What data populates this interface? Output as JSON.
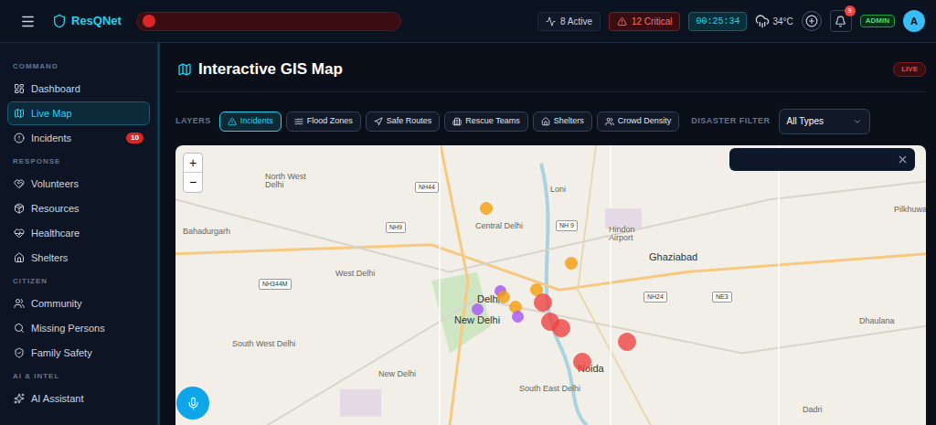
{
  "app": {
    "name": "ResQNet"
  },
  "topbar": {
    "active": "8 Active",
    "critical": "12 Critical",
    "timer": "00:25:34",
    "temperature": "34°C",
    "notifications": "9",
    "role": "ADMIN",
    "avatar": "A"
  },
  "sidebar": {
    "sections": [
      {
        "title": "COMMAND",
        "items": [
          {
            "label": "Dashboard",
            "selected": false
          },
          {
            "label": "Live Map",
            "selected": true
          },
          {
            "label": "Incidents",
            "selected": false,
            "badge": "10"
          }
        ]
      },
      {
        "title": "RESPONSE",
        "items": [
          {
            "label": "Volunteers",
            "selected": false
          },
          {
            "label": "Resources",
            "selected": false
          },
          {
            "label": "Healthcare",
            "selected": false
          },
          {
            "label": "Shelters",
            "selected": false
          }
        ]
      },
      {
        "title": "CITIZEN",
        "items": [
          {
            "label": "Community",
            "selected": false
          },
          {
            "label": "Missing Persons",
            "selected": false
          },
          {
            "label": "Family Safety",
            "selected": false
          }
        ]
      },
      {
        "title": "AI & INTEL",
        "items": [
          {
            "label": "AI Assistant",
            "selected": false
          }
        ]
      }
    ]
  },
  "page": {
    "title": "Interactive GIS Map",
    "live": "LIVE"
  },
  "layers": {
    "label": "LAYERS",
    "items": [
      {
        "label": "Incidents",
        "selected": true
      },
      {
        "label": "Flood Zones",
        "selected": false
      },
      {
        "label": "Safe Routes",
        "selected": false
      },
      {
        "label": "Rescue Teams",
        "selected": false
      },
      {
        "label": "Shelters",
        "selected": false
      },
      {
        "label": "Crowd Density",
        "selected": false
      }
    ]
  },
  "filter": {
    "label": "DISASTER FILTER",
    "value": "All Types"
  },
  "map": {
    "zoom_in": "+",
    "zoom_out": "−",
    "labels": [
      {
        "text": "North West Delhi",
        "kind": "place"
      },
      {
        "text": "Bahadurgarh",
        "kind": "place"
      },
      {
        "text": "Central Delhi",
        "kind": "place"
      },
      {
        "text": "Loni",
        "kind": "place"
      },
      {
        "text": "Hindon Airport",
        "kind": "place"
      },
      {
        "text": "Ghaziabad",
        "kind": "city"
      },
      {
        "text": "West Delhi",
        "kind": "place"
      },
      {
        "text": "Delhi",
        "kind": "city"
      },
      {
        "text": "New Delhi",
        "kind": "city"
      },
      {
        "text": "South West Delhi",
        "kind": "place"
      },
      {
        "text": "Noida",
        "kind": "city"
      },
      {
        "text": "South East Delhi",
        "kind": "place"
      },
      {
        "text": "New Delhi",
        "kind": "place"
      },
      {
        "text": "Dhaulana",
        "kind": "place"
      },
      {
        "text": "Dadri",
        "kind": "place"
      },
      {
        "text": "Pilkhuwa",
        "kind": "place"
      },
      {
        "text": "NH44",
        "kind": "road"
      },
      {
        "text": "NH9",
        "kind": "road"
      },
      {
        "text": "NH 9",
        "kind": "road"
      },
      {
        "text": "NH24",
        "kind": "road"
      },
      {
        "text": "NE3",
        "kind": "road"
      },
      {
        "text": "NH344M",
        "kind": "road"
      }
    ],
    "markers": [
      {
        "severity": "medium",
        "color": "#f59e0b"
      },
      {
        "severity": "medium",
        "color": "#f59e0b"
      },
      {
        "severity": "medium",
        "color": "#f59e0b"
      },
      {
        "severity": "low",
        "color": "#a855f7"
      },
      {
        "severity": "medium",
        "color": "#f59e0b"
      },
      {
        "severity": "medium",
        "color": "#f59e0b"
      },
      {
        "severity": "critical",
        "color": "#ef4444"
      },
      {
        "severity": "low",
        "color": "#a855f7"
      },
      {
        "severity": "low",
        "color": "#a855f7"
      },
      {
        "severity": "critical",
        "color": "#ef4444"
      },
      {
        "severity": "critical",
        "color": "#ef4444"
      },
      {
        "severity": "critical",
        "color": "#ef4444"
      },
      {
        "severity": "critical",
        "color": "#ef4444"
      }
    ]
  }
}
